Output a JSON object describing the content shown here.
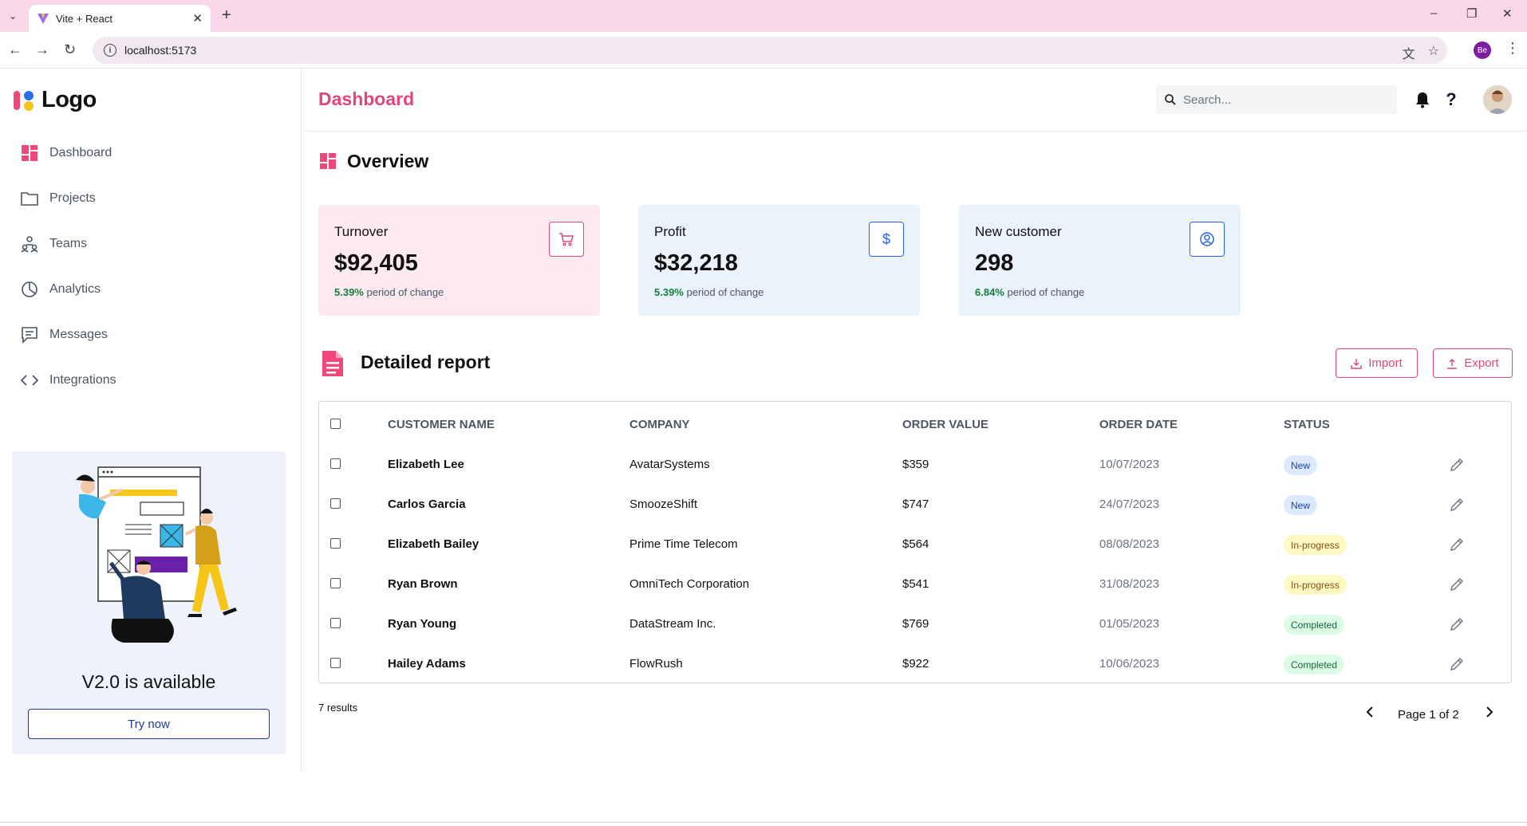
{
  "browser": {
    "tab_title": "Vite + React",
    "url": "localhost:5173",
    "profile_initials": "Be"
  },
  "sidebar": {
    "logo_text": "Logo",
    "items": [
      {
        "label": "Dashboard",
        "icon": "dashboard-icon",
        "active": true
      },
      {
        "label": "Projects",
        "icon": "folder-icon"
      },
      {
        "label": "Teams",
        "icon": "teams-icon"
      },
      {
        "label": "Analytics",
        "icon": "pie-chart-icon"
      },
      {
        "label": "Messages",
        "icon": "message-icon"
      },
      {
        "label": "Integrations",
        "icon": "code-icon"
      }
    ],
    "promo": {
      "title": "V2.0 is available",
      "button": "Try now"
    }
  },
  "header": {
    "title": "Dashboard",
    "search_placeholder": "Search..."
  },
  "overview": {
    "title": "Overview",
    "cards": [
      {
        "title": "Turnover",
        "value": "$92,405",
        "change": "5.39%",
        "change_label": "period of change",
        "icon": "cart-icon"
      },
      {
        "title": "Profit",
        "value": "$32,218",
        "change": "5.39%",
        "change_label": "period of change",
        "icon": "dollar-icon"
      },
      {
        "title": "New customer",
        "value": "298",
        "change": "6.84%",
        "change_label": "period of change",
        "icon": "user-circle-icon"
      }
    ]
  },
  "report": {
    "title": "Detailed report",
    "import_label": "Import",
    "export_label": "Export",
    "columns": [
      "CUSTOMER NAME",
      "COMPANY",
      "ORDER VALUE",
      "ORDER DATE",
      "STATUS"
    ],
    "rows": [
      {
        "name": "Elizabeth Lee",
        "company": "AvatarSystems",
        "value": "$359",
        "date": "10/07/2023",
        "status": "New"
      },
      {
        "name": "Carlos Garcia",
        "company": "SmoozeShift",
        "value": "$747",
        "date": "24/07/2023",
        "status": "New"
      },
      {
        "name": "Elizabeth Bailey",
        "company": "Prime Time Telecom",
        "value": "$564",
        "date": "08/08/2023",
        "status": "In-progress"
      },
      {
        "name": "Ryan Brown",
        "company": "OmniTech Corporation",
        "value": "$541",
        "date": "31/08/2023",
        "status": "In-progress"
      },
      {
        "name": "Ryan Young",
        "company": "DataStream Inc.",
        "value": "$769",
        "date": "01/05/2023",
        "status": "Completed"
      },
      {
        "name": "Hailey Adams",
        "company": "FlowRush",
        "value": "$922",
        "date": "10/06/2023",
        "status": "Completed"
      }
    ],
    "results": "7 results",
    "page_label": "Page 1 of 2"
  },
  "colors": {
    "accent": "#e0457b",
    "profit_accent": "#2563eb",
    "customer_accent": "#2563eb"
  }
}
